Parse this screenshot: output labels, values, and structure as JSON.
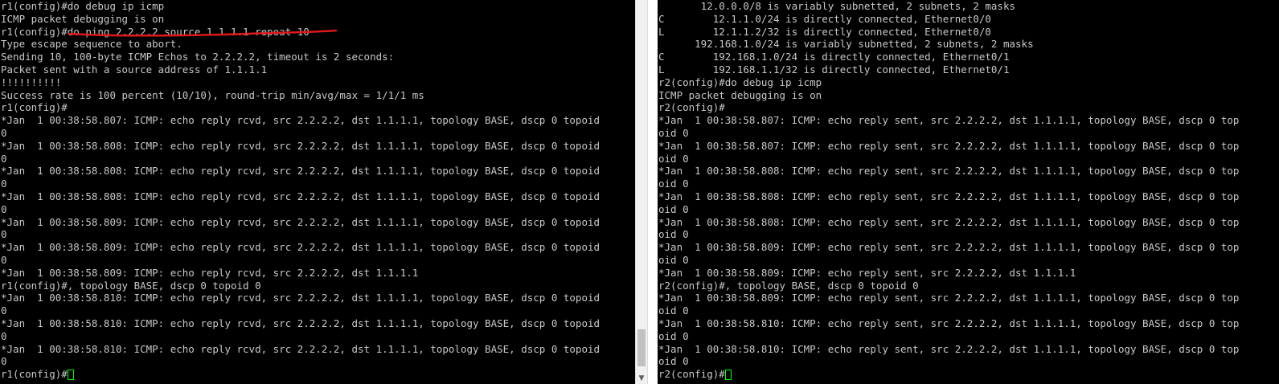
{
  "left_terminal": {
    "lines": [
      "r1(config)#do debug ip icmp",
      "ICMP packet debugging is on",
      "r1(config)#do ping 2.2.2.2 source 1.1.1.1 repeat 10",
      "Type escape sequence to abort.",
      "Sending 10, 100-byte ICMP Echos to 2.2.2.2, timeout is 2 seconds:",
      "Packet sent with a source address of 1.1.1.1",
      "!!!!!!!!!!",
      "Success rate is 100 percent (10/10), round-trip min/avg/max = 1/1/1 ms",
      "r1(config)#",
      "*Jan  1 00:38:58.807: ICMP: echo reply rcvd, src 2.2.2.2, dst 1.1.1.1, topology BASE, dscp 0 topoid",
      "0",
      "*Jan  1 00:38:58.808: ICMP: echo reply rcvd, src 2.2.2.2, dst 1.1.1.1, topology BASE, dscp 0 topoid",
      "0",
      "*Jan  1 00:38:58.808: ICMP: echo reply rcvd, src 2.2.2.2, dst 1.1.1.1, topology BASE, dscp 0 topoid",
      "0",
      "*Jan  1 00:38:58.808: ICMP: echo reply rcvd, src 2.2.2.2, dst 1.1.1.1, topology BASE, dscp 0 topoid",
      "0",
      "*Jan  1 00:38:58.809: ICMP: echo reply rcvd, src 2.2.2.2, dst 1.1.1.1, topology BASE, dscp 0 topoid",
      "0",
      "*Jan  1 00:38:58.809: ICMP: echo reply rcvd, src 2.2.2.2, dst 1.1.1.1, topology BASE, dscp 0 topoid",
      "0",
      "*Jan  1 00:38:58.809: ICMP: echo reply rcvd, src 2.2.2.2, dst 1.1.1.1",
      "r1(config)#, topology BASE, dscp 0 topoid 0",
      "*Jan  1 00:38:58.810: ICMP: echo reply rcvd, src 2.2.2.2, dst 1.1.1.1, topology BASE, dscp 0 topoid",
      "0",
      "*Jan  1 00:38:58.810: ICMP: echo reply rcvd, src 2.2.2.2, dst 1.1.1.1, topology BASE, dscp 0 topoid",
      "0",
      "*Jan  1 00:38:58.810: ICMP: echo reply rcvd, src 2.2.2.2, dst 1.1.1.1, topology BASE, dscp 0 topoid",
      "0"
    ],
    "prompt": "r1(config)#"
  },
  "right_terminal": {
    "lines": [
      "       12.0.0.0/8 is variably subnetted, 2 subnets, 2 masks",
      "C        12.1.1.0/24 is directly connected, Ethernet0/0",
      "L        12.1.1.2/32 is directly connected, Ethernet0/0",
      "      192.168.1.0/24 is variably subnetted, 2 subnets, 2 masks",
      "C        192.168.1.0/24 is directly connected, Ethernet0/1",
      "L        192.168.1.1/32 is directly connected, Ethernet0/1",
      "r2(config)#do debug ip icmp",
      "ICMP packet debugging is on",
      "r2(config)#",
      "*Jan  1 00:38:58.807: ICMP: echo reply sent, src 2.2.2.2, dst 1.1.1.1, topology BASE, dscp 0 top",
      "oid 0",
      "*Jan  1 00:38:58.807: ICMP: echo reply sent, src 2.2.2.2, dst 1.1.1.1, topology BASE, dscp 0 top",
      "oid 0",
      "*Jan  1 00:38:58.808: ICMP: echo reply sent, src 2.2.2.2, dst 1.1.1.1, topology BASE, dscp 0 top",
      "oid 0",
      "*Jan  1 00:38:58.808: ICMP: echo reply sent, src 2.2.2.2, dst 1.1.1.1, topology BASE, dscp 0 top",
      "oid 0",
      "*Jan  1 00:38:58.808: ICMP: echo reply sent, src 2.2.2.2, dst 1.1.1.1, topology BASE, dscp 0 top",
      "oid 0",
      "*Jan  1 00:38:58.809: ICMP: echo reply sent, src 2.2.2.2, dst 1.1.1.1, topology BASE, dscp 0 top",
      "oid 0",
      "*Jan  1 00:38:58.809: ICMP: echo reply sent, src 2.2.2.2, dst 1.1.1.1",
      "r2(config)#, topology BASE, dscp 0 topoid 0",
      "*Jan  1 00:38:58.809: ICMP: echo reply sent, src 2.2.2.2, dst 1.1.1.1, topology BASE, dscp 0 top",
      "oid 0",
      "*Jan  1 00:38:58.810: ICMP: echo reply sent, src 2.2.2.2, dst 1.1.1.1, topology BASE, dscp 0 top",
      "oid 0",
      "*Jan  1 00:38:58.810: ICMP: echo reply sent, src 2.2.2.2, dst 1.1.1.1, topology BASE, dscp 0 top",
      "oid 0"
    ],
    "prompt": "r2(config)#"
  },
  "colors": {
    "terminal_bg": "#000000",
    "terminal_text": "#c8c8c8",
    "cursor": "#00ff00",
    "annotation_underline": "#e0181b"
  },
  "icons": {
    "scroll_down": "chevron-down-icon"
  }
}
